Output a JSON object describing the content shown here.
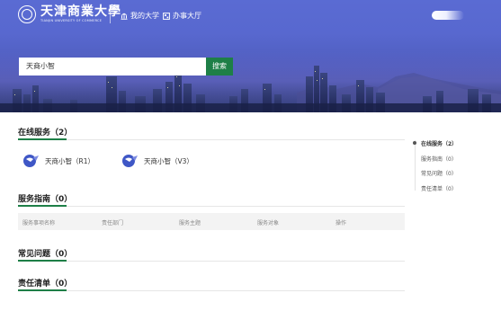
{
  "header": {
    "logo_cn": "天津商業大學",
    "logo_en": "TIANJIN UNIVERSITY OF COMMERCE",
    "nav": [
      {
        "label": "我的大学",
        "icon": "building-icon"
      },
      {
        "label": "办事大厅",
        "icon": "hall-icon"
      }
    ]
  },
  "search": {
    "value": "天商小智",
    "button_label": "搜索"
  },
  "sections": {
    "online_services": {
      "title": "在线服务（2）",
      "items": [
        {
          "name": "天商小智（R1）",
          "icon": "service-logo-icon"
        },
        {
          "name": "天商小智（V3）",
          "icon": "service-logo-icon"
        }
      ]
    },
    "service_guide": {
      "title": "服务指南（0）",
      "columns": [
        "服务事项名称",
        "责任部门",
        "服务主题",
        "服务对象",
        "操作"
      ]
    },
    "faq": {
      "title": "常见问题（0）"
    },
    "responsibility": {
      "title": "责任清单（0）"
    }
  },
  "side_nav": [
    {
      "label": "在线服务（2）",
      "active": true
    },
    {
      "label": "服务指南（0）",
      "active": false
    },
    {
      "label": "常见问题（0）",
      "active": false
    },
    {
      "label": "责任清单（0）",
      "active": false
    }
  ],
  "colors": {
    "accent_green": "#1e7f47",
    "header_blue": "#5a6bd3"
  }
}
